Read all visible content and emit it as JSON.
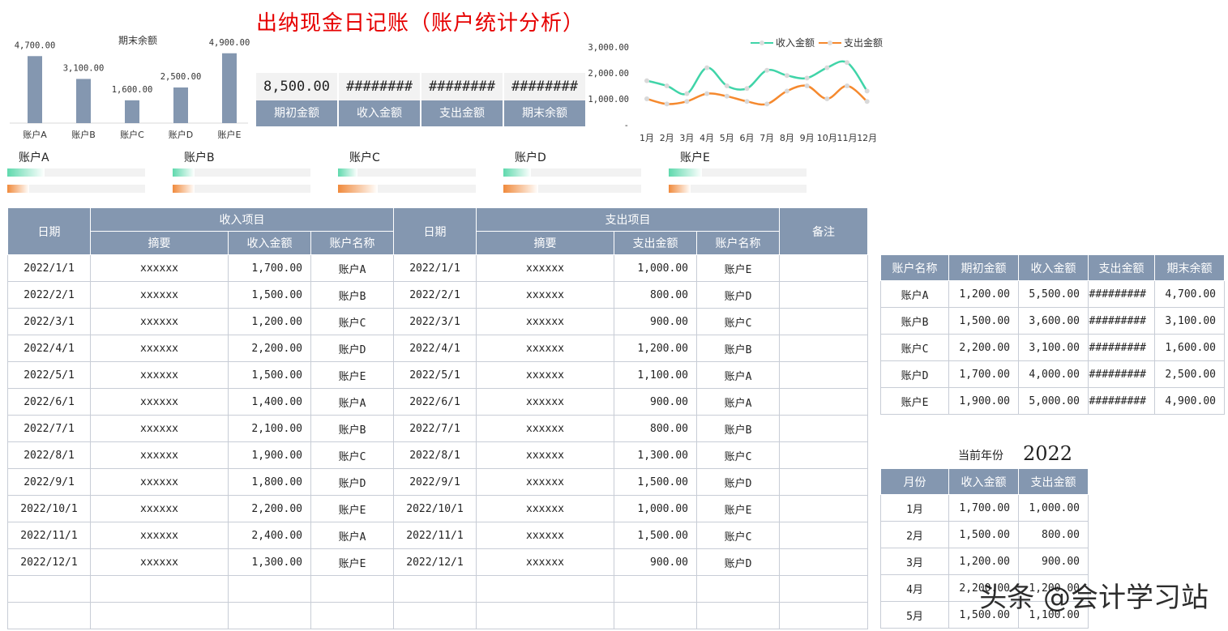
{
  "title": "出纳现金日记账（账户统计分析）",
  "colors": {
    "header_bg": "#8497b0",
    "income": "#40d4a8",
    "expense": "#f5892e",
    "bar": "#8497b0",
    "title": "#e60000"
  },
  "bar_chart": {
    "title": "期末余额",
    "values_text": [
      "4,700.00",
      "3,100.00",
      "1,600.00",
      "2,500.00",
      "4,900.00"
    ],
    "categories": [
      "账户A",
      "账户B",
      "账户C",
      "账户D",
      "账户E"
    ]
  },
  "summary": {
    "values": [
      "8,500.00",
      "########",
      "########",
      "########"
    ],
    "labels": [
      "期初金额",
      "收入金额",
      "支出金额",
      "期末余额"
    ]
  },
  "line_chart_text": {
    "legend": [
      "收入金额",
      "支出金额"
    ],
    "y_ticks": [
      "3,000.00",
      "2,000.00",
      "1,000.00",
      "-"
    ],
    "x_ticks": [
      "1月",
      "2月",
      "3月",
      "4月",
      "5月",
      "6月",
      "7月",
      "8月",
      "9月",
      "10月",
      "11月",
      "12月"
    ]
  },
  "progress": {
    "accounts": [
      {
        "name": "账户A",
        "income": 0.27,
        "expense": 0.16
      },
      {
        "name": "账户B",
        "income": 0.16,
        "expense": 0.16
      },
      {
        "name": "账户C",
        "income": 0.14,
        "expense": 0.29
      },
      {
        "name": "账户D",
        "income": 0.2,
        "expense": 0.25
      },
      {
        "name": "账户E",
        "income": 0.24,
        "expense": 0.16
      }
    ]
  },
  "main_table": {
    "headers": {
      "date": "日期",
      "income_group": "收入项目",
      "summary": "摘要",
      "income_amount": "收入金额",
      "account": "账户名称",
      "expense_group": "支出项目",
      "expense_amount": "支出金额",
      "note": "备注"
    },
    "rows": [
      [
        "2022/1/1",
        "xxxxxx",
        "1,700.00",
        "账户A",
        "2022/1/1",
        "xxxxxx",
        "1,000.00",
        "账户E",
        ""
      ],
      [
        "2022/2/1",
        "xxxxxx",
        "1,500.00",
        "账户B",
        "2022/2/1",
        "xxxxxx",
        "800.00",
        "账户D",
        ""
      ],
      [
        "2022/3/1",
        "xxxxxx",
        "1,200.00",
        "账户C",
        "2022/3/1",
        "xxxxxx",
        "900.00",
        "账户C",
        ""
      ],
      [
        "2022/4/1",
        "xxxxxx",
        "2,200.00",
        "账户D",
        "2022/4/1",
        "xxxxxx",
        "1,200.00",
        "账户B",
        ""
      ],
      [
        "2022/5/1",
        "xxxxxx",
        "1,500.00",
        "账户E",
        "2022/5/1",
        "xxxxxx",
        "1,100.00",
        "账户A",
        ""
      ],
      [
        "2022/6/1",
        "xxxxxx",
        "1,400.00",
        "账户A",
        "2022/6/1",
        "xxxxxx",
        "900.00",
        "账户A",
        ""
      ],
      [
        "2022/7/1",
        "xxxxxx",
        "2,100.00",
        "账户B",
        "2022/7/1",
        "xxxxxx",
        "800.00",
        "账户B",
        ""
      ],
      [
        "2022/8/1",
        "xxxxxx",
        "1,900.00",
        "账户C",
        "2022/8/1",
        "xxxxxx",
        "1,300.00",
        "账户C",
        ""
      ],
      [
        "2022/9/1",
        "xxxxxx",
        "1,800.00",
        "账户D",
        "2022/9/1",
        "xxxxxx",
        "1,500.00",
        "账户D",
        ""
      ],
      [
        "2022/10/1",
        "xxxxxx",
        "2,200.00",
        "账户E",
        "2022/10/1",
        "xxxxxx",
        "1,000.00",
        "账户E",
        ""
      ],
      [
        "2022/11/1",
        "xxxxxx",
        "2,400.00",
        "账户A",
        "2022/11/1",
        "xxxxxx",
        "1,500.00",
        "账户C",
        ""
      ],
      [
        "2022/12/1",
        "xxxxxx",
        "1,300.00",
        "账户E",
        "2022/12/1",
        "xxxxxx",
        "900.00",
        "账户D",
        ""
      ],
      [
        "",
        "",
        "",
        "",
        "",
        "",
        "",
        "",
        ""
      ],
      [
        "",
        "",
        "",
        "",
        "",
        "",
        "",
        "",
        ""
      ]
    ]
  },
  "account_table": {
    "headers": [
      "账户名称",
      "期初金额",
      "收入金额",
      "支出金额",
      "期末余额"
    ],
    "rows": [
      [
        "账户A",
        "1,200.00",
        "5,500.00",
        "#########",
        "4,700.00"
      ],
      [
        "账户B",
        "1,500.00",
        "3,600.00",
        "#########",
        "3,100.00"
      ],
      [
        "账户C",
        "2,200.00",
        "3,100.00",
        "#########",
        "1,600.00"
      ],
      [
        "账户D",
        "1,700.00",
        "4,000.00",
        "#########",
        "2,500.00"
      ],
      [
        "账户E",
        "1,900.00",
        "5,000.00",
        "#########",
        "4,900.00"
      ]
    ]
  },
  "year": {
    "label": "当前年份",
    "value": "2022"
  },
  "month_table": {
    "headers": [
      "月份",
      "收入金额",
      "支出金额"
    ],
    "rows": [
      [
        "1月",
        "1,700.00",
        "1,000.00"
      ],
      [
        "2月",
        "1,500.00",
        "800.00"
      ],
      [
        "3月",
        "1,200.00",
        "900.00"
      ],
      [
        "4月",
        "2,200.00",
        "1,200.00"
      ],
      [
        "5月",
        "1,500.00",
        "1,100.00"
      ]
    ]
  },
  "watermark": "头条 @会计学习站",
  "chart_data": [
    {
      "type": "bar",
      "title": "期末余额",
      "categories": [
        "账户A",
        "账户B",
        "账户C",
        "账户D",
        "账户E"
      ],
      "values": [
        4700,
        3100,
        1600,
        2500,
        4900
      ],
      "ylim": [
        0,
        5000
      ]
    },
    {
      "type": "line",
      "categories": [
        "1月",
        "2月",
        "3月",
        "4月",
        "5月",
        "6月",
        "7月",
        "8月",
        "9月",
        "10月",
        "11月",
        "12月"
      ],
      "series": [
        {
          "name": "收入金额",
          "values": [
            1700,
            1500,
            1200,
            2200,
            1500,
            1400,
            2100,
            1900,
            1800,
            2200,
            2400,
            1300
          ]
        },
        {
          "name": "支出金额",
          "values": [
            1000,
            800,
            900,
            1200,
            1100,
            900,
            800,
            1300,
            1500,
            1000,
            1500,
            900
          ]
        }
      ],
      "ylim": [
        0,
        3000
      ],
      "legend": "top-right"
    }
  ]
}
